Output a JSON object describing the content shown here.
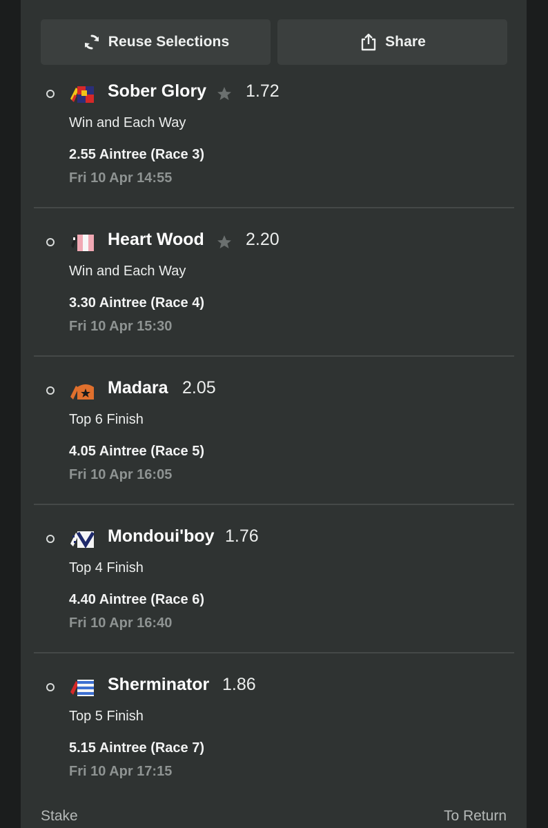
{
  "actions": {
    "reuse_label": "Reuse Selections",
    "share_label": "Share"
  },
  "selections": [
    {
      "name": "Sober Glory",
      "odds": "1.72",
      "market": "Win and Each Way",
      "race": "2.55 Aintree (Race 3)",
      "time": "Fri 10 Apr 14:55",
      "favourite": true,
      "silk": "silk-red-yellow-checks"
    },
    {
      "name": "Heart Wood",
      "odds": "2.20",
      "market": "Win and Each Way",
      "race": "3.30 Aintree (Race 4)",
      "time": "Fri 10 Apr 15:30",
      "favourite": true,
      "silk": "silk-pink-white"
    },
    {
      "name": "Madara",
      "odds": "2.05",
      "market": "Top 6 Finish",
      "race": "4.05 Aintree (Race 5)",
      "time": "Fri 10 Apr 16:05",
      "favourite": false,
      "silk": "silk-orange-star"
    },
    {
      "name": "Mondoui'boy",
      "odds": "1.76",
      "market": "Top 4 Finish",
      "race": "4.40 Aintree (Race 6)",
      "time": "Fri 10 Apr 16:40",
      "favourite": false,
      "silk": "silk-white-navy-v"
    },
    {
      "name": "Sherminator",
      "odds": "1.86",
      "market": "Top 5 Finish",
      "race": "5.15 Aintree (Race 7)",
      "time": "Fri 10 Apr 17:15",
      "favourite": false,
      "silk": "silk-blue-white-hoops"
    }
  ],
  "footer": {
    "stake_label": "Stake",
    "return_label": "To Return"
  },
  "colors": {
    "background": "#2f3332",
    "button": "#3b3f3e",
    "divider": "#454948",
    "muted_text": "#8e9392"
  }
}
